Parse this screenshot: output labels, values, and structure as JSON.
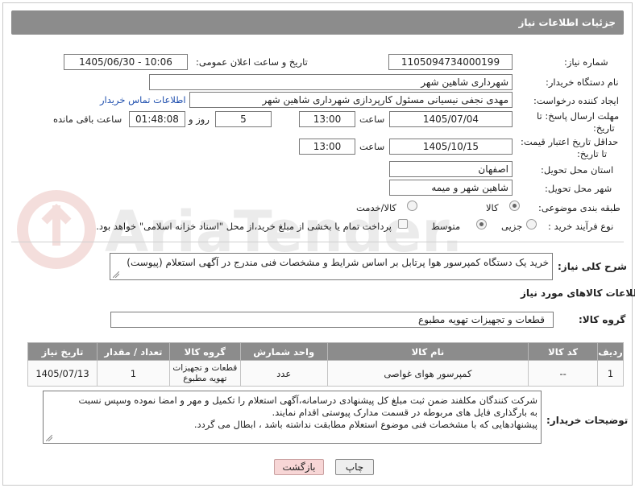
{
  "header": {
    "title": "جزئیات اطلاعات نیاز"
  },
  "form": {
    "need_number_label": "شماره نیاز:",
    "need_number": "1105094734000199",
    "announce_label": "تاریخ و ساعت اعلان عمومی:",
    "announce_value": "1405/06/30 - 10:06",
    "buyer_org_label": "نام دستگاه خریدار:",
    "buyer_org": "شهرداری شاهین شهر",
    "creator_label": "ایجاد کننده درخواست:",
    "creator": "مهدی نجفی نیسیانی مسئول کارپردازی شهرداری شاهین شهر",
    "contact_link": "اطلاعات تماس خریدار",
    "deadline_label_1": "مهلت ارسال پاسخ: تا",
    "deadline_label_2": "تاریخ:",
    "deadline_date": "1405/07/04",
    "time_label": "ساعت",
    "deadline_time": "13:00",
    "days_value": "5",
    "days_and_label": "روز و",
    "remaining_time": "01:48:08",
    "remaining_label": "ساعت باقی مانده",
    "min_validity_label_1": "حداقل تاریخ اعتبار قیمت:",
    "min_validity_label_2": "تا تاریخ:",
    "validity_date": "1405/10/15",
    "validity_time": "13:00",
    "province_label": "استان محل تحویل:",
    "province": "اصفهان",
    "city_label": "شهر محل تحویل:",
    "city": "شاهین شهر و میمه",
    "category_label": "طبقه بندی موضوعی:",
    "category_goods": "کالا",
    "category_goods_services": "کالا/خدمت",
    "process_label": "نوع فرآیند خرید :",
    "process_partial": "جزیی",
    "process_medium": "متوسط",
    "payment_note": "پرداخت تمام یا بخشی از مبلغ خرید،از محل \"اسناد خزانه اسلامی\" خواهد بود."
  },
  "description": {
    "label": "شرح کلی نیاز:",
    "text": "خرید یک دستگاه کمپرسور هوا پرتابل بر اساس شرایط و مشخصات فنی مندرج در آگهی استعلام (پیوست)"
  },
  "goods_info_title": "اطلاعات کالاهای مورد نیاز",
  "goods_group": {
    "label": "گروه کالا:",
    "value": "قطعات و تجهیزات تهویه مطبوع"
  },
  "table": {
    "headers": [
      "ردیف",
      "کد کالا",
      "نام کالا",
      "واحد شمارش",
      "گروه کالا",
      "تعداد / مقدار",
      "تاریخ نیاز"
    ],
    "rows": [
      [
        "1",
        "--",
        "کمپرسور هوای غواصی",
        "عدد",
        "قطعات و تجهیزات تهویه مطبوع",
        "1",
        "1405/07/13"
      ]
    ]
  },
  "buyer_notes": {
    "label": "توضیحات خریدار:",
    "line1": "شرکت کنندگان مکلفند ضمن ثبت مبلغ کل پیشنهادی درسامانه،آگهی استعلام را  تکمیل و مهر و امضا نموده وسپس نسبت",
    "line2": "به بارگذاری فایل های مربوطه در قسمت مدارک پیوستی اقدام نمایند.",
    "line3": "پیشنهادهایی که با مشخصات فنی موضوع استعلام مطابقت نداشته باشد ، ابطال می گردد."
  },
  "buttons": {
    "print": "چاپ",
    "back": "بازگشت"
  },
  "watermark_text": "AriaTender.neT",
  "colors": {
    "header_bg": "#8c8c8c",
    "link": "#1f4fae",
    "back_button_bg": "#f7d6d6",
    "print_button_bg": "#eeeeee"
  }
}
